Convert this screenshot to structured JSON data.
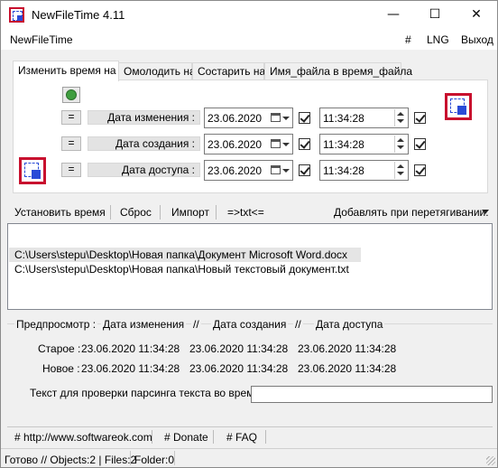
{
  "window": {
    "title": "NewFileTime 4.11",
    "minimize": "—",
    "maximize": "☐",
    "close": "✕"
  },
  "menu": {
    "app": "NewFileTime",
    "hash": "#",
    "lng": "LNG",
    "exit": "Выход"
  },
  "tabs": [
    {
      "label": "Изменить время на"
    },
    {
      "label": "Омолодить на"
    },
    {
      "label": "Состарить на"
    },
    {
      "label": "Имя_файла в время_файла"
    }
  ],
  "rows": [
    {
      "eq": "=",
      "label": "Дата изменения :",
      "date": "23.06.2020",
      "time": "11:34:28"
    },
    {
      "eq": "=",
      "label": "Дата создания :",
      "date": "23.06.2020",
      "time": "11:34:28"
    },
    {
      "eq": "=",
      "label": "Дата доступа :",
      "date": "23.06.2020",
      "time": "11:34:28"
    }
  ],
  "toolbar": {
    "set_time": "Установить время",
    "reset": "Сброс",
    "import": "Импорт",
    "txt": "=>txt<=",
    "drag_add": "Добавлять при перетягивании:"
  },
  "files": [
    "C:\\Users\\stepu\\Desktop\\Новая папка\\Документ Microsoft Word.docx",
    "C:\\Users\\stepu\\Desktop\\Новая папка\\Новый текстовый документ.txt"
  ],
  "preview": {
    "header_label": "Предпросмотр :",
    "col_modified": "Дата изменения",
    "sep1": "//",
    "col_created": "Дата создания",
    "sep2": "//",
    "col_accessed": "Дата доступа",
    "old_label": "Старое :",
    "new_label": "Новое :",
    "old": [
      "23.06.2020 11:34:28",
      "23.06.2020 11:34:28",
      "23.06.2020 11:34:28"
    ],
    "new": [
      "23.06.2020 11:34:28",
      "23.06.2020 11:34:28",
      "23.06.2020 11:34:28"
    ]
  },
  "parse": {
    "label": "Текст для проверки парсинга текста во время",
    "value": ""
  },
  "links": {
    "website": "# http://www.softwareok.com",
    "donate": "# Donate",
    "faq": "# FAQ"
  },
  "status": {
    "ready": "Готово // Objects:2 | Files:2",
    "folder": "Folder:0"
  }
}
